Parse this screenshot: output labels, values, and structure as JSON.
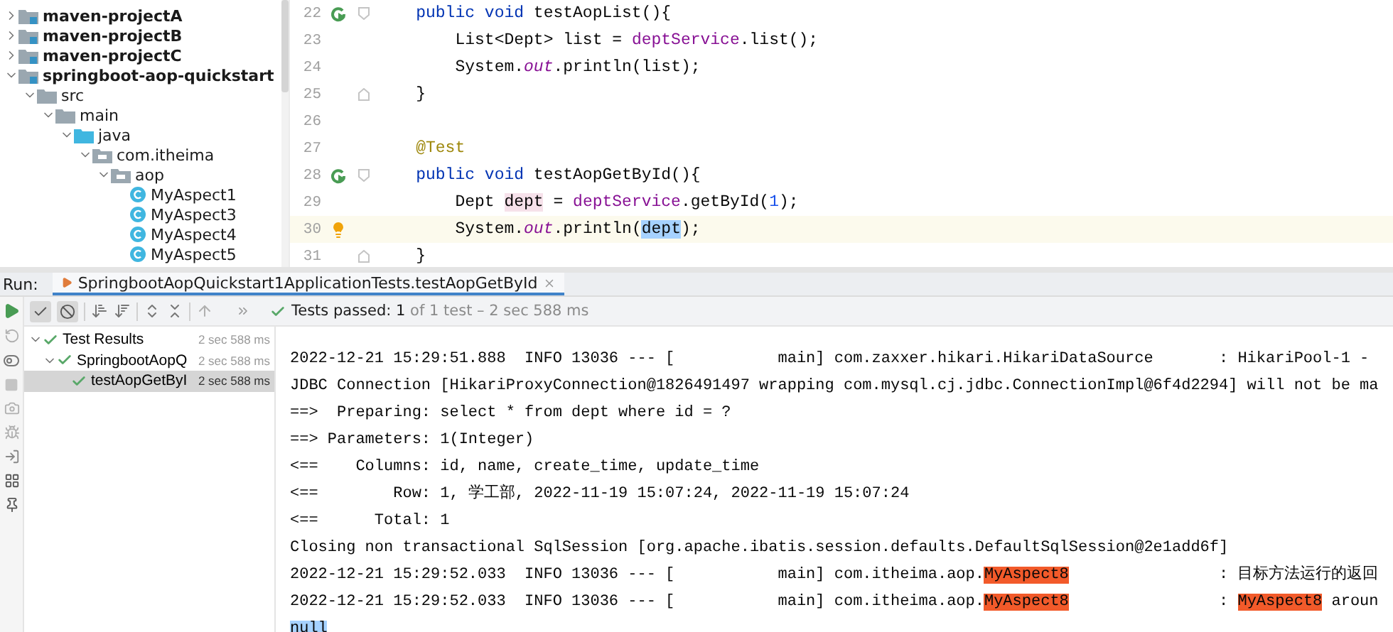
{
  "project_tree": [
    {
      "label": "maven-projectA",
      "kind": "module",
      "expanded": false
    },
    {
      "label": "maven-projectB",
      "kind": "module",
      "expanded": false
    },
    {
      "label": "maven-projectC",
      "kind": "module",
      "expanded": false
    },
    {
      "label": "springboot-aop-quickstart",
      "kind": "module",
      "expanded": true,
      "children": [
        {
          "label": "src",
          "kind": "folder",
          "expanded": true,
          "children": [
            {
              "label": "main",
              "kind": "folder",
              "expanded": true,
              "children": [
                {
                  "label": "java",
                  "kind": "source-folder",
                  "expanded": true,
                  "children": [
                    {
                      "label": "com.itheima",
                      "kind": "package",
                      "expanded": true,
                      "children": [
                        {
                          "label": "aop",
                          "kind": "package",
                          "expanded": true,
                          "children": [
                            {
                              "label": "MyAspect1",
                              "kind": "class"
                            },
                            {
                              "label": "MyAspect3",
                              "kind": "class"
                            },
                            {
                              "label": "MyAspect4",
                              "kind": "class"
                            },
                            {
                              "label": "MyAspect5",
                              "kind": "class"
                            }
                          ]
                        }
                      ]
                    }
                  ]
                }
              ]
            }
          ]
        }
      ]
    }
  ],
  "editor": {
    "lines": [
      {
        "number": "22",
        "run_marker": true,
        "fold_start": true,
        "fold_end": false,
        "bulb": false,
        "current": false,
        "tokens": [
          {
            "text": "    public void ",
            "kind": "keyword"
          },
          {
            "text": "testAopList(){",
            "kind": "plain"
          }
        ]
      },
      {
        "number": "23",
        "run_marker": false,
        "fold_start": false,
        "fold_end": false,
        "bulb": false,
        "current": false,
        "tokens": [
          {
            "text": "        List<Dept> list = ",
            "kind": "plain"
          },
          {
            "text": "deptService",
            "kind": "field"
          },
          {
            "text": ".list();",
            "kind": "plain"
          }
        ]
      },
      {
        "number": "24",
        "run_marker": false,
        "fold_start": false,
        "fold_end": false,
        "bulb": false,
        "current": false,
        "tokens": [
          {
            "text": "        System.",
            "kind": "plain"
          },
          {
            "text": "out",
            "kind": "static"
          },
          {
            "text": ".println(list);",
            "kind": "plain"
          }
        ]
      },
      {
        "number": "25",
        "run_marker": false,
        "fold_start": false,
        "fold_end": true,
        "bulb": false,
        "current": false,
        "tokens": [
          {
            "text": "    }",
            "kind": "plain"
          }
        ]
      },
      {
        "number": "26",
        "run_marker": false,
        "fold_start": false,
        "fold_end": false,
        "bulb": false,
        "current": false
      },
      {
        "number": "27",
        "run_marker": false,
        "fold_start": false,
        "fold_end": false,
        "bulb": false,
        "current": false,
        "tokens": [
          {
            "text": "    @Test",
            "kind": "annotation"
          }
        ]
      },
      {
        "number": "28",
        "run_marker": true,
        "fold_start": true,
        "fold_end": false,
        "bulb": false,
        "current": false,
        "tokens": [
          {
            "text": "    public void ",
            "kind": "keyword"
          },
          {
            "text": "testAopGetById(){",
            "kind": "plain"
          }
        ]
      },
      {
        "number": "29",
        "run_marker": false,
        "fold_start": false,
        "fold_end": false,
        "bulb": false,
        "current": false,
        "tokens": [
          {
            "text": "        Dept ",
            "kind": "plain"
          },
          {
            "text": "dept",
            "kind": "write-usage"
          },
          {
            "text": " = ",
            "kind": "plain"
          },
          {
            "text": "deptService",
            "kind": "field"
          },
          {
            "text": ".getById(",
            "kind": "plain"
          },
          {
            "text": "1",
            "kind": "number"
          },
          {
            "text": ");",
            "kind": "plain"
          }
        ]
      },
      {
        "number": "30",
        "run_marker": false,
        "fold_start": false,
        "fold_end": false,
        "bulb": true,
        "current": true,
        "tokens": [
          {
            "text": "        System.",
            "kind": "plain"
          },
          {
            "text": "out",
            "kind": "static"
          },
          {
            "text": ".println(",
            "kind": "plain"
          },
          {
            "text": "dept",
            "kind": "selection"
          },
          {
            "text": ");",
            "kind": "plain"
          }
        ]
      },
      {
        "number": "31",
        "run_marker": false,
        "fold_start": false,
        "fold_end": true,
        "bulb": false,
        "current": false,
        "tokens": [
          {
            "text": "    }",
            "kind": "plain"
          }
        ]
      }
    ]
  },
  "run_panel": {
    "label": "Run:",
    "tab": {
      "title": "SpringbootAopQuickstart1ApplicationTests.testAopGetById",
      "selected": true
    },
    "toolbar": [
      {
        "kind": "show-passed",
        "selected": true
      },
      {
        "kind": "show-ignored",
        "selected": true
      }
    ],
    "status": "**Tests passed: 1** of 1 test – 2 sec 588 ms"
  },
  "test_results": [
    {
      "label": "Test Results",
      "time": "2 sec 588 ms",
      "passed": true,
      "expanded": true,
      "selected": false,
      "children": [
        {
          "label": "SpringbootAopQ",
          "time": "2 sec 588 ms",
          "passed": true,
          "expanded": true,
          "selected": false,
          "children": [
            {
              "label": "testAopGetByI",
              "time": "2 sec 588 ms",
              "passed": true,
              "selected": true
            }
          ]
        }
      ]
    }
  ],
  "console": [
    {
      "segments": [
        {
          "text": "2022-12-21 15:29:51.888  INFO 13036 --- [           main] com.zaxxer.hikari.HikariDataSource       : HikariPool-1 -",
          "kind": "plain"
        }
      ]
    },
    {
      "segments": [
        {
          "text": "JDBC Connection [HikariProxyConnection@1826491497 wrapping com.mysql.cj.jdbc.ConnectionImpl@6f4d2294] will not be ma",
          "kind": "plain"
        }
      ]
    },
    {
      "segments": [
        {
          "text": "==>  Preparing: select * from dept where id = ?",
          "kind": "plain"
        }
      ]
    },
    {
      "segments": [
        {
          "text": "==> Parameters: 1(Integer)",
          "kind": "plain"
        }
      ]
    },
    {
      "segments": [
        {
          "text": "<==    Columns: id, name, create_time, update_time",
          "kind": "plain"
        }
      ]
    },
    {
      "segments": [
        {
          "text": "<==        Row: 1, 学工部, 2022-11-19 15:07:24, 2022-11-19 15:07:24",
          "kind": "plain"
        }
      ]
    },
    {
      "segments": [
        {
          "text": "<==      Total: 1",
          "kind": "plain"
        }
      ]
    },
    {
      "segments": [
        {
          "text": "Closing non transactional SqlSession [org.apache.ibatis.session.defaults.DefaultSqlSession@2e1add6f]",
          "kind": "plain"
        }
      ]
    },
    {
      "segments": [
        {
          "text": "2022-12-21 15:29:52.033  INFO 13036 --- [           main] com.itheima.aop.",
          "kind": "plain"
        },
        {
          "text": "MyAspect8",
          "kind": "match"
        },
        {
          "text": "                : 目标方法运行的返回",
          "kind": "plain"
        }
      ]
    },
    {
      "segments": [
        {
          "text": "2022-12-21 15:29:52.033  INFO 13036 --- [           main] com.itheima.aop.",
          "kind": "plain"
        },
        {
          "text": "MyAspect8",
          "kind": "match"
        },
        {
          "text": "                : ",
          "kind": "plain"
        },
        {
          "text": "MyAspect8",
          "kind": "match"
        },
        {
          "text": " aroun",
          "kind": "plain"
        }
      ]
    },
    {
      "segments": [
        {
          "text": "null",
          "kind": "selection"
        }
      ]
    }
  ]
}
